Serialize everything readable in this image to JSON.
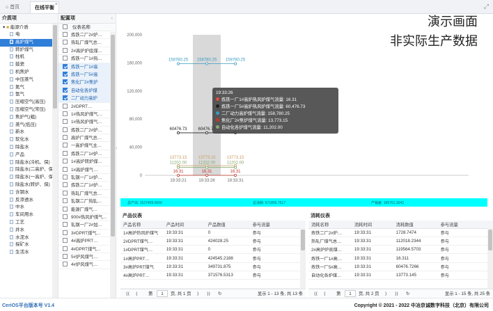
{
  "tabs": [
    {
      "label": "首页",
      "icon": "home-icon"
    },
    {
      "label": "在线平衡",
      "close": "×"
    }
  ],
  "top_right_icon": "expand-icon",
  "left_panel": {
    "title": "介质项",
    "root": "能源介质",
    "items": [
      "电",
      "高炉煤气",
      "转炉煤气",
      "柱机",
      "鼓瓷",
      "机焦炉",
      "中压蒸气",
      "氮气",
      "氩气",
      "压缩空气(高压)",
      "压缩空气(常压)",
      "焦炉气(粗)",
      "蒸气(低压)",
      "新水",
      "软化水",
      "除盐水",
      "产品",
      "除盐水(冷机、保)",
      "除盐水(二高炉、保)",
      "除盐水(一高炉、保)",
      "除盐水(转炉、保)",
      "含钢水",
      "反渗透水",
      "中水",
      "车间用水",
      "工艺",
      "井水",
      "水泥水",
      "探矿水",
      "生活水"
    ],
    "selected_index": 1
  },
  "config_panel": {
    "title": "配置项",
    "header": "仪表名称",
    "items": [
      {
        "label": "炼铁二厂2#炉…",
        "checked": false
      },
      {
        "label": "热轧厂煤气总…",
        "checked": false
      },
      {
        "label": "2#高炉炉底煤…",
        "checked": false
      },
      {
        "label": "炼铁一厂1#热…",
        "checked": false
      },
      {
        "label": "炼铁一厂1#高",
        "checked": true
      },
      {
        "label": "炼铁一厂5#高",
        "checked": true
      },
      {
        "label": "焦化厂2#焦炉",
        "checked": true
      },
      {
        "label": "自动化各炉煤",
        "checked": true
      },
      {
        "label": "二厂动力高炉",
        "checked": true
      },
      {
        "label": "2#DPRT…",
        "checked": false
      },
      {
        "label": "1#热风炉煤气…",
        "checked": false
      },
      {
        "label": "1#热风炉煤气…",
        "checked": false
      },
      {
        "label": "炼铁二厂2#炉…",
        "checked": false
      },
      {
        "label": "高炉厂煤气总…",
        "checked": false
      },
      {
        "label": "一高炉煤气主…",
        "checked": false
      },
      {
        "label": "炼铁二厂1#炉…",
        "checked": false
      },
      {
        "label": "1#高炉转炉煤…",
        "checked": false
      },
      {
        "label": "1#高炉煤气…",
        "checked": false
      },
      {
        "label": "轧钢一厂1#炉…",
        "checked": false
      },
      {
        "label": "炼铁二厂1#炉…",
        "checked": false
      },
      {
        "label": "热轧厂煤气总…",
        "checked": false
      },
      {
        "label": "轧钢二厂热轧…",
        "checked": false
      },
      {
        "label": "能源厂煤气…",
        "checked": false
      },
      {
        "label": "900#热风炉煤气…",
        "checked": false
      },
      {
        "label": "轧钢一厂2#加…",
        "checked": false
      },
      {
        "label": "3#DPRT煤气…",
        "checked": false
      },
      {
        "label": "4#高炉PRT…",
        "checked": false
      },
      {
        "label": "4#DPRT煤气…",
        "checked": false
      },
      {
        "label": "5#炉风煤气…",
        "checked": false
      },
      {
        "label": "4#炉风煤气…",
        "checked": false
      }
    ]
  },
  "watermark": {
    "line1": "演示画面",
    "line2": "非实际生产数据"
  },
  "chart_data": {
    "type": "line",
    "x": [
      "19:33:21",
      "19:33:26",
      "19:33:31"
    ],
    "ylim": [
      0,
      200000
    ],
    "yticks": [
      "0",
      "40,000",
      "80,000",
      "120,000",
      "160,000",
      "200,000"
    ],
    "highlight_x": "19:33:26",
    "series": [
      {
        "name": "炼铁一厂1#高炉热风炉煤气流量",
        "values": [
          158780.25,
          158780.25,
          158780.25
        ],
        "color": "#3a9bc1",
        "labels": [
          "158780.25",
          "158780.25",
          "158780.25"
        ]
      },
      {
        "name": "炼铁一厂5#高炉热风炉煤气流量",
        "values": [
          60476.73,
          60476.73,
          60476.73
        ],
        "color": "#222222",
        "labels": [
          "60476.73",
          "60476.73",
          ""
        ]
      },
      {
        "name": "焦化厂2#焦炉煤气流量",
        "values": [
          13773.15,
          13773.15,
          13773.15
        ],
        "color": "#c8a060",
        "labels": [
          "13773.15",
          "13773.15",
          "13773.15"
        ]
      },
      {
        "name": "自动化各炉煤气流量",
        "values": [
          11202,
          11202,
          11202
        ],
        "color": "#8aa870",
        "labels": [
          "11202.00",
          "11202.00",
          "11202.00"
        ]
      },
      {
        "name": "二厂动力高炉煤气流量",
        "values": [
          16.31,
          16.31,
          16.31
        ],
        "color": "#c0392b",
        "labels": [
          "16.31",
          "16.31",
          "16.31"
        ]
      }
    ]
  },
  "tooltip": {
    "time": "19:33:26",
    "rows": [
      {
        "text": "炼铁一厂1#高炉热风炉煤气流量: 16.31",
        "color": "#e74c3c"
      },
      {
        "text": "炼铁一厂5#高炉热风炉煤气流量: 60,476.73",
        "color": "#222222"
      },
      {
        "text": "二厂动力高炉煤气流量: 158,780.25",
        "color": "#3a9bc1"
      },
      {
        "text": "焦化厂2#焦炉煤气流量: 13,773.15",
        "color": "#c0392b"
      },
      {
        "text": "自动化各炉煤气流量: 11,202.00",
        "color": "#8aa870"
      }
    ]
  },
  "summary_bar": {
    "a": "总产出: 1527409.0000",
    "b": "总消耗: 671806.7517",
    "c": "产销差: 185761.3042"
  },
  "produce_panel": {
    "title": "产品仪表",
    "columns": [
      "产品名称",
      "产品时间",
      "产品数值",
      "参与流量"
    ],
    "rows": [
      [
        "1#高炉热风炉煤气",
        "19:33:31",
        "0",
        "参与"
      ],
      [
        "2#DPRT煤气…",
        "19:33:31",
        "424028.25",
        "参与"
      ],
      [
        "1#DPRT煤气…",
        "19:33:31",
        "0",
        "参与"
      ],
      [
        "1#高炉PRT…",
        "19:33:31",
        "424545.2188",
        "参与"
      ],
      [
        "3#高炉PRT煤气",
        "19:33:31",
        "349731.875",
        "参与"
      ],
      [
        "4#高炉PRT…",
        "19:33:31",
        "371576.5313",
        "参与"
      ],
      [
        "",
        "",
        "",
        ""
      ]
    ],
    "pager": {
      "first": "⟨⟨",
      "prev": "⟨",
      "page_label": "第",
      "page": "1",
      "of": "页, 共 1 页",
      "next": "⟩",
      "last": "⟩⟩",
      "refresh": "↻",
      "info": "显示 1 - 13 条, 共 13 条"
    }
  },
  "consume_panel": {
    "title": "消耗仪表",
    "columns": [
      "消耗名称",
      "消耗时间",
      "消耗数值",
      "参与流量"
    ],
    "rows": [
      [
        "炼铁二厂2#炉…",
        "19:33:31",
        "1728.7474",
        "参与"
      ],
      [
        "热轧厂煤气总…",
        "19:33:31",
        "112018.2344",
        "参与"
      ],
      [
        "2#高炉炉底煤…",
        "19:33:31",
        "119564.5703",
        "参与"
      ],
      [
        "炼铁一厂1#高…",
        "19:33:31",
        "16.311",
        "参与"
      ],
      [
        "炼铁一厂5#高…",
        "19:33:31",
        "60476.7266",
        "参与"
      ],
      [
        "自动化各炉煤…",
        "19:33:31",
        "13773.145",
        "参与"
      ],
      [
        "",
        "",
        "",
        ""
      ]
    ],
    "pager": {
      "first": "⟨⟨",
      "prev": "⟨",
      "page_label": "第",
      "page": "1",
      "of": "页, 共 2 页",
      "next": "⟩",
      "last": "⟩⟩",
      "refresh": "↻",
      "info": "显示 1 - 15 条, 共 25 条"
    }
  },
  "footer": {
    "left": "CeriOS平台版本号 V1.4",
    "right": "Copyright © 2021 - 2022 中冶京诚数字科技（北京）有限公司"
  }
}
